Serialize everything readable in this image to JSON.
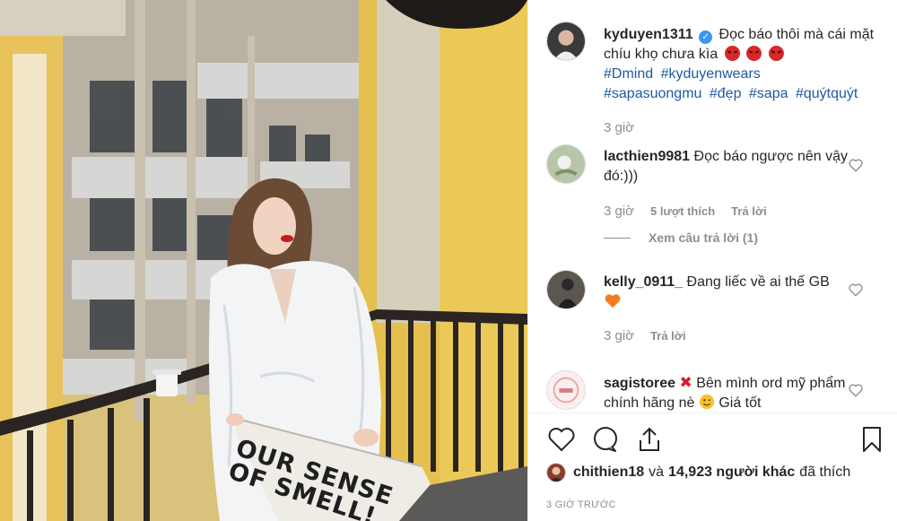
{
  "post": {
    "author": "kyduyen1311",
    "caption_text": "Đọc báo thôi mà cái mặt chíu khọ chưa kìa",
    "caption_emojis": [
      "angry-face-emoji",
      "angry-face-emoji",
      "angry-face-emoji"
    ],
    "hashtags": [
      "#Dmind",
      "#kyduyenwears",
      "#sapasuongmu",
      "#đẹp",
      "#sapa",
      "#quýtquýt"
    ],
    "time": "3 giờ",
    "newspaper_text": "OUR SENSE OF SMELL!"
  },
  "comments": [
    {
      "user": "lacthien9981",
      "text": "Đọc báo ngược nên vậy đó:)))",
      "time": "3 giờ",
      "likes": "5 lượt thích",
      "reply": "Trả lời",
      "view_replies": "Xem câu trả lời (1)"
    },
    {
      "user": "kelly_0911_",
      "text": "Đang liếc về ai thế GB",
      "time": "3 giờ",
      "reply": "Trả lời"
    },
    {
      "user": "sagistoree",
      "text": "Bên mình ord mỹ phẩm chính hãng nè",
      "text_tail": "Giá tốt"
    }
  ],
  "likes": {
    "first_user": "chithien18",
    "joiner": "và",
    "others": "14,923 người khác",
    "suffix": "đã thích"
  },
  "posted_ago": "3 GIỜ TRƯỚC",
  "colors": {
    "link": "#1e5ba0",
    "secondary": "#8e8e8e",
    "verified": "#3897f0",
    "wall": "#e9c24e"
  }
}
